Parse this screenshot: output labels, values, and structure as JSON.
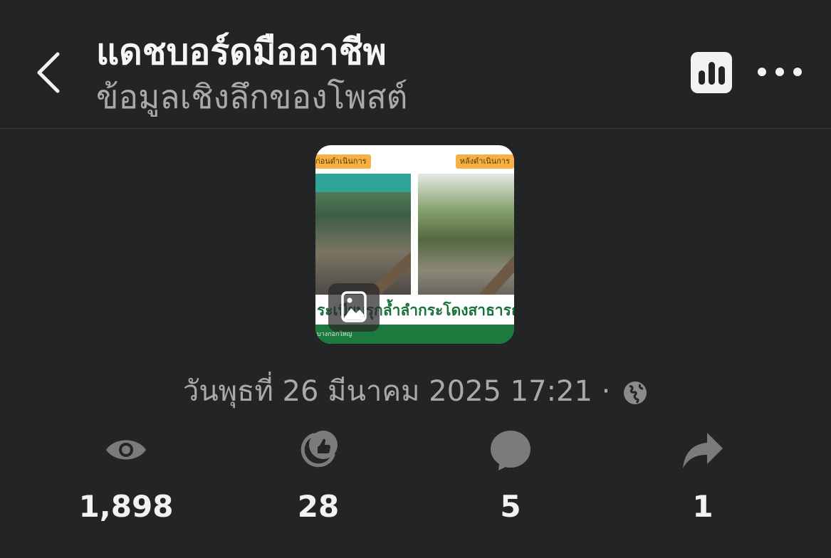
{
  "header": {
    "title": "แดชบอร์ดมืออาชีพ",
    "subtitle": "ข้อมูลเชิงลึกของโพสต์",
    "back_icon": "chevron-left-icon",
    "insights_icon": "bar-chart-icon",
    "more_icon": "more-dots-icon"
  },
  "post": {
    "thumbnail": {
      "tag_before": "ก่อนดำเนินการ",
      "tag_after": "หลังดำเนินการ",
      "caption": "ระเบียบรุกล้ำลำกระโดงสาธารณ",
      "footer": "บางกอกใหญ่",
      "gallery_icon": "image-gallery-icon"
    },
    "date": "วันพุธที่ 26 มีนาคม  2025 17:21 ·",
    "privacy_icon": "globe-icon"
  },
  "stats": [
    {
      "icon": "eye-icon",
      "value": "1,898"
    },
    {
      "icon": "reaction-icon",
      "value": "28"
    },
    {
      "icon": "comment-icon",
      "value": "5"
    },
    {
      "icon": "share-icon",
      "value": "1"
    }
  ],
  "colors": {
    "background": "#232426",
    "primary_text": "#f5f5f5",
    "secondary_text": "#a8a9ab",
    "icon_gray": "#7a7b7d"
  }
}
